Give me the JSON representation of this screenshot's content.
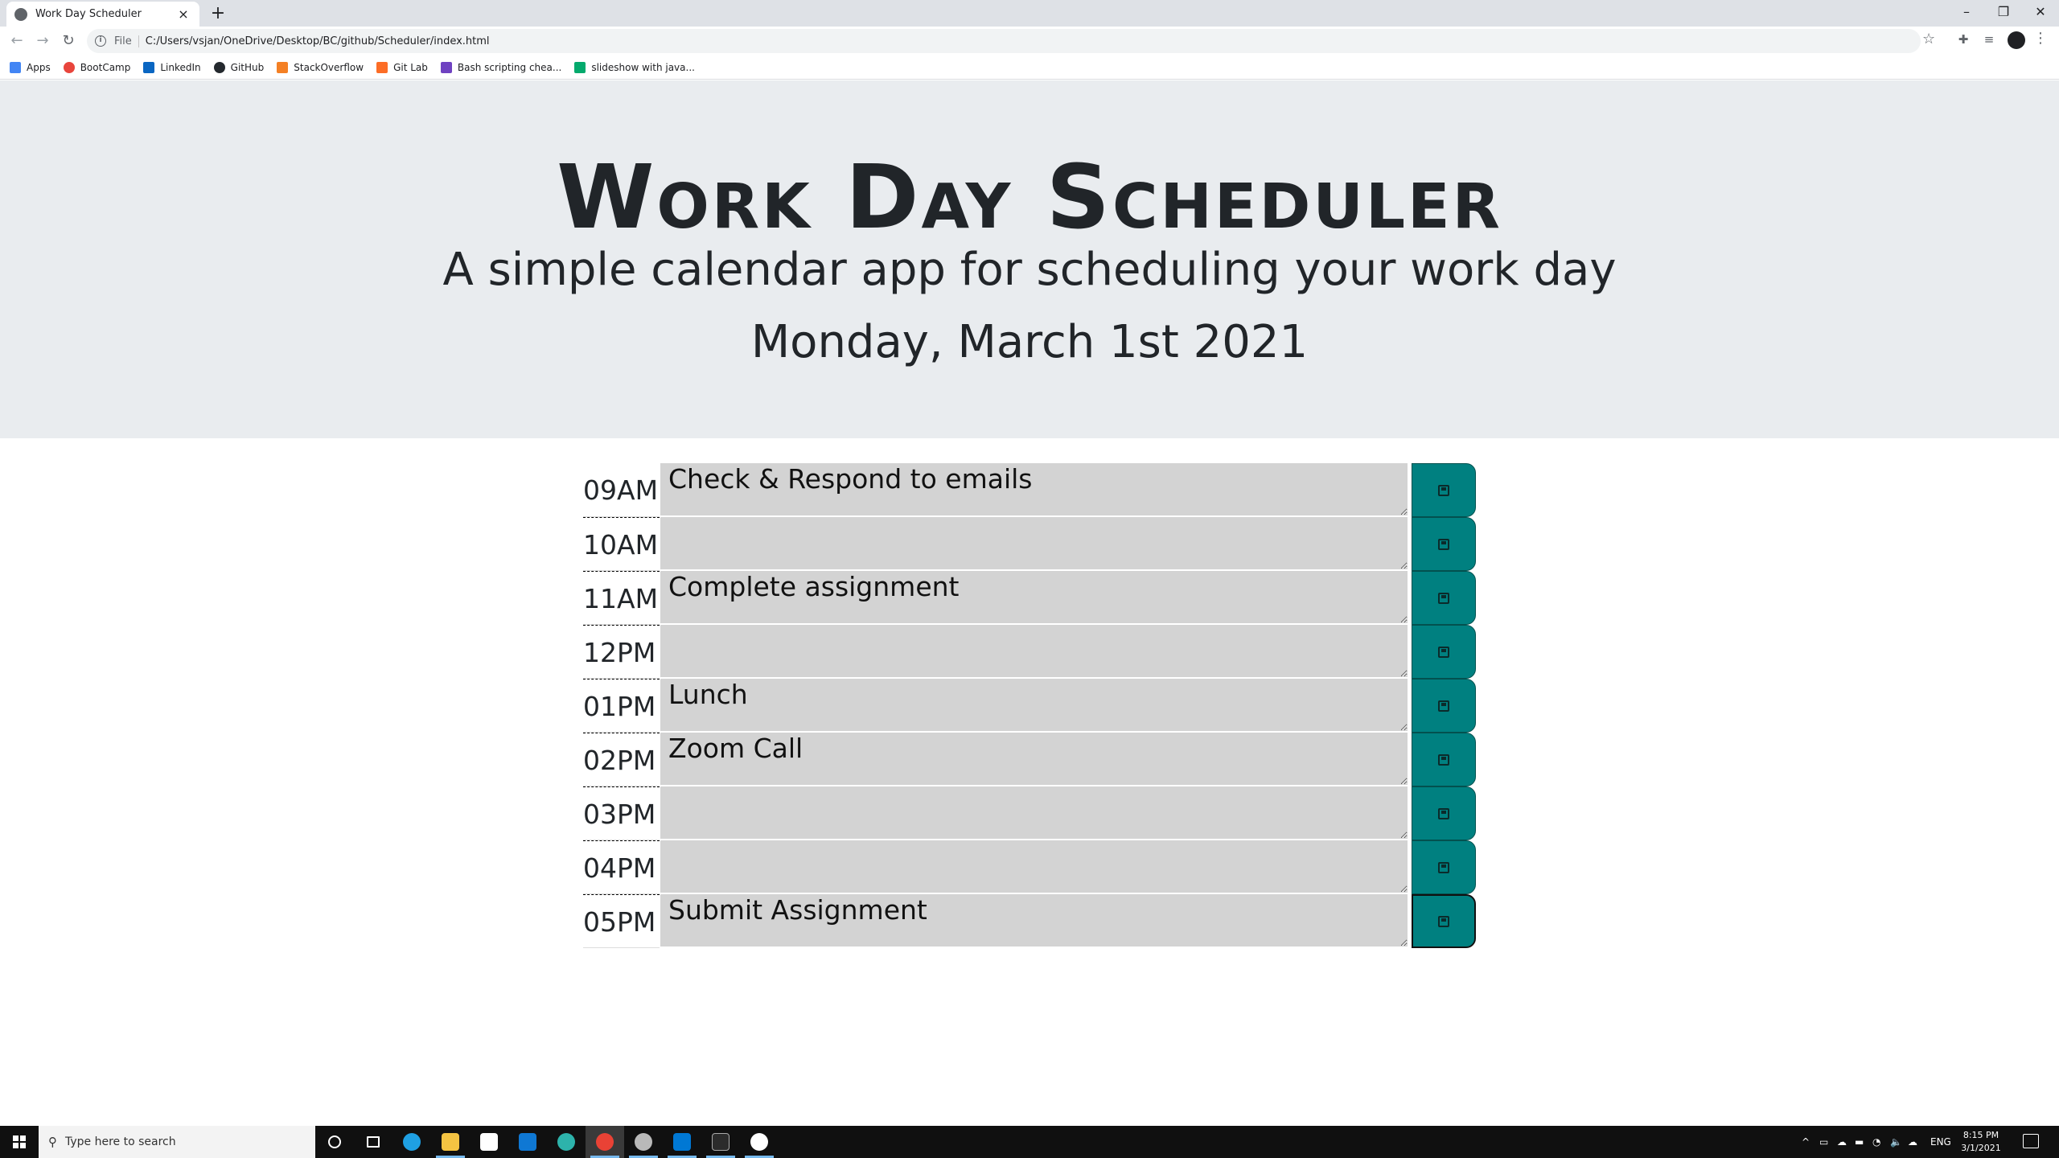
{
  "browser": {
    "tab_title": "Work Day Scheduler",
    "url_scheme": "File",
    "url": "C:/Users/vsjan/OneDrive/Desktop/BC/github/Scheduler/index.html",
    "bookmarks": [
      "Apps",
      "BootCamp",
      "LinkedIn",
      "GitHub",
      "StackOverflow",
      "Git Lab",
      "Bash scripting chea...",
      "slideshow with java..."
    ]
  },
  "header": {
    "title": "Work Day Scheduler",
    "lead": "A simple calendar app for scheduling your work day",
    "current_day": "Monday, March 1st 2021"
  },
  "schedule": [
    {
      "hour": "09AM",
      "text": "Check & Respond to emails"
    },
    {
      "hour": "10AM",
      "text": ""
    },
    {
      "hour": "11AM",
      "text": "Complete assignment"
    },
    {
      "hour": "12PM",
      "text": ""
    },
    {
      "hour": "01PM",
      "text": "Lunch"
    },
    {
      "hour": "02PM",
      "text": "Zoom Call"
    },
    {
      "hour": "03PM",
      "text": ""
    },
    {
      "hour": "04PM",
      "text": ""
    },
    {
      "hour": "05PM",
      "text": "Submit Assignment"
    }
  ],
  "colors": {
    "past": "#d3d3d3",
    "save_button": "#008080",
    "jumbotron": "#e9ecef"
  },
  "taskbar": {
    "search_placeholder": "Type here to search",
    "language": "ENG",
    "time": "8:15 PM",
    "date": "3/1/2021"
  }
}
